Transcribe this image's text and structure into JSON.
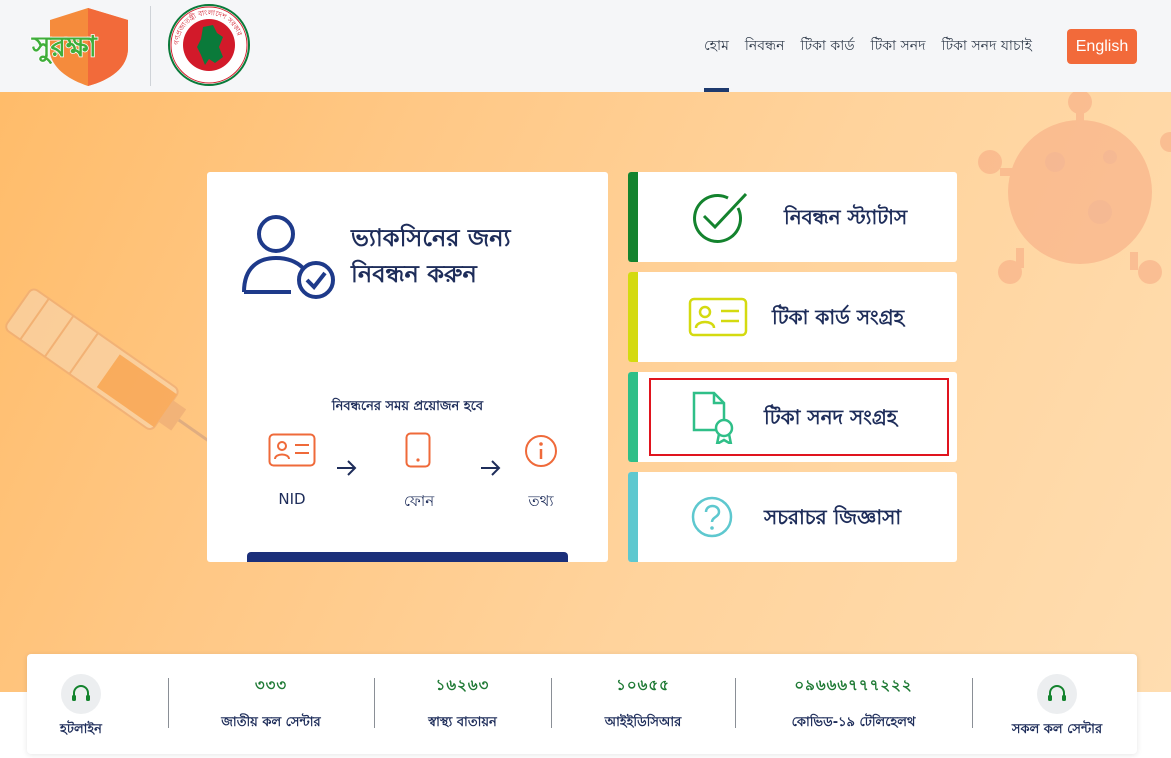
{
  "header": {
    "logo_text": "সুরক্ষা",
    "gov_seal_text": "গণপ্রজাতন্ত্রী বাংলাদেশ সরকার",
    "nav": [
      {
        "label": "হোম",
        "active": true
      },
      {
        "label": "নিবন্ধন",
        "active": false
      },
      {
        "label": "টিকা কার্ড",
        "active": false
      },
      {
        "label": "টিকা সনদ",
        "active": false
      },
      {
        "label": "টিকা সনদ যাচাই",
        "active": false
      }
    ],
    "lang_button": "English"
  },
  "register": {
    "title_line1": "ভ্যাকসিনের জন্য",
    "title_line2": "নিবন্ধন করুন",
    "required_label": "নিবন্ধনের সময় প্রয়োজন হবে",
    "requirements": [
      "NID",
      "ফোন",
      "তথ্য"
    ]
  },
  "tiles": [
    {
      "label": "নিবন্ধন স্ট্যাটাস",
      "accent": "#14832e",
      "icon": "check-circle-icon"
    },
    {
      "label": "টিকা কার্ড সংগ্রহ",
      "accent": "#d4da10",
      "icon": "id-card-icon"
    },
    {
      "label": "টিকা সনদ সংগ্রহ",
      "accent": "#2fbf88",
      "icon": "certificate-icon"
    },
    {
      "label": "সচরাচর জিজ্ঞাসা",
      "accent": "#5ec8cf",
      "icon": "question-circle-icon"
    }
  ],
  "hotline": {
    "left_label": "হটলাইন",
    "numbers": [
      {
        "number": "৩৩৩",
        "label": "জাতীয় কল সেন্টার"
      },
      {
        "number": "১৬২৬৩",
        "label": "স্বাস্থ্য বাতায়ন"
      },
      {
        "number": "১০৬৫৫",
        "label": "আইইডিসিআর"
      },
      {
        "number": "০৯৬৬৬৭৭৭২২২",
        "label": "কোভিড-১৯ টেলিহেলথ"
      }
    ],
    "right_label": "সকল কল সেন্টার"
  },
  "colors": {
    "brand_orange": "#f26a3a",
    "navy": "#1e2d5a",
    "hotline_green": "#1f7a35",
    "highlight_red": "#e0141e"
  }
}
